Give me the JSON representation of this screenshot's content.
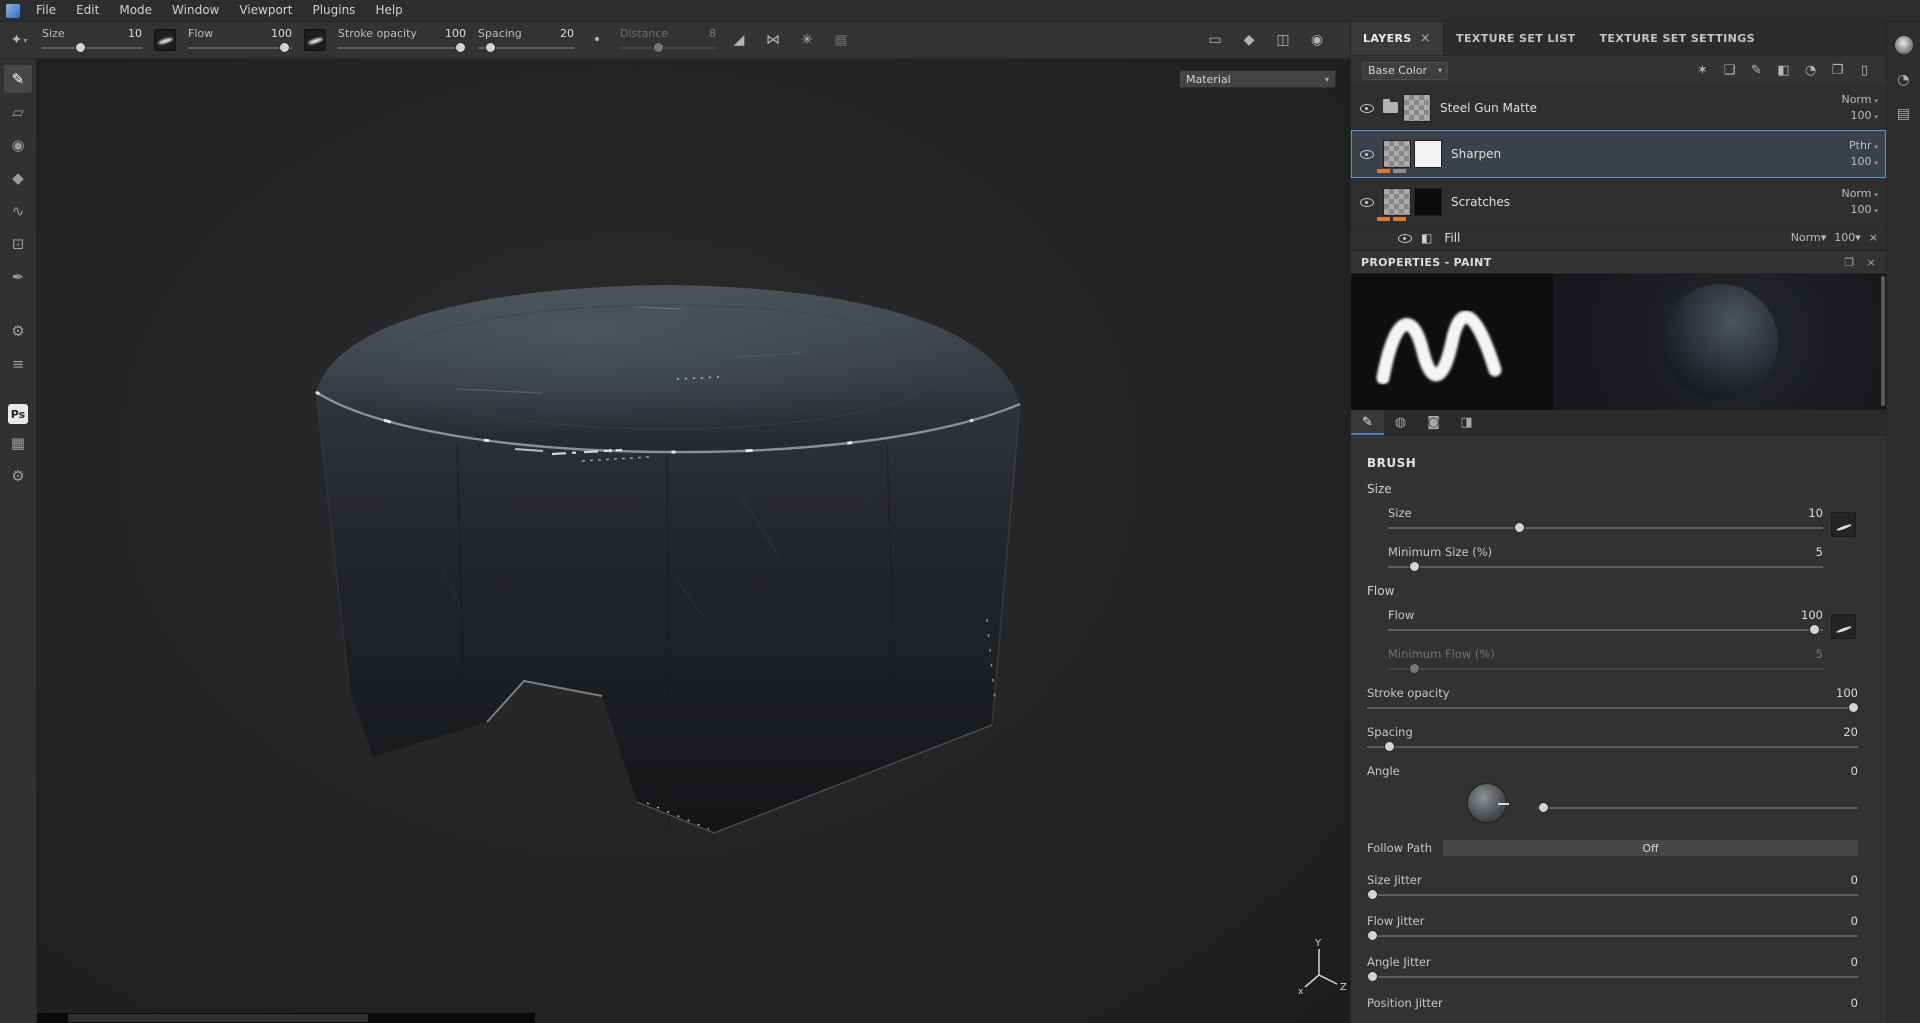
{
  "menubar": {
    "items": [
      "File",
      "Edit",
      "Mode",
      "Window",
      "Viewport",
      "Plugins",
      "Help"
    ]
  },
  "toolbar": {
    "size": {
      "label": "Size",
      "value": "10"
    },
    "flow": {
      "label": "Flow",
      "value": "100"
    },
    "stroke_opacity": {
      "label": "Stroke opacity",
      "value": "100"
    },
    "spacing": {
      "label": "Spacing",
      "value": "20"
    },
    "distance": {
      "label": "Distance",
      "value": "8"
    }
  },
  "viewport": {
    "material_select": "Material",
    "axis": {
      "x": "x",
      "y": "Y",
      "z": "Z"
    }
  },
  "layers_panel": {
    "tabs": [
      {
        "label": "LAYERS"
      },
      {
        "label": "TEXTURE SET LIST"
      },
      {
        "label": "TEXTURE SET SETTINGS"
      }
    ],
    "channel_select": "Base Color",
    "layers": [
      {
        "name": "Steel Gun Matte",
        "blend": "Norm",
        "opacity": "100"
      },
      {
        "name": "Sharpen",
        "blend": "Pthr",
        "opacity": "100"
      },
      {
        "name": "Scratches",
        "blend": "Norm",
        "opacity": "100"
      },
      {
        "name": "Fill",
        "blend": "Norm",
        "opacity": "100"
      }
    ]
  },
  "properties_panel": {
    "title": "PROPERTIES - PAINT",
    "section_title": "BRUSH",
    "group_size": "Size",
    "group_flow": "Flow",
    "rows": {
      "size": {
        "label": "Size",
        "value": "10"
      },
      "min_size": {
        "label": "Minimum Size (%)",
        "value": "5"
      },
      "flow": {
        "label": "Flow",
        "value": "100"
      },
      "min_flow": {
        "label": "Minimum Flow (%)",
        "value": "5"
      },
      "stroke_opacity": {
        "label": "Stroke opacity",
        "value": "100"
      },
      "spacing": {
        "label": "Spacing",
        "value": "20"
      },
      "angle": {
        "label": "Angle",
        "value": "0"
      },
      "follow_path": {
        "label": "Follow Path",
        "value": "Off"
      },
      "size_jitter": {
        "label": "Size Jitter",
        "value": "0"
      },
      "flow_jitter": {
        "label": "Flow Jitter",
        "value": "0"
      },
      "angle_jitter": {
        "label": "Angle Jitter",
        "value": "0"
      },
      "position_jitter": {
        "label": "Position Jitter",
        "value": "0"
      }
    }
  },
  "icons": {
    "chevron_down": "▾",
    "close": "×",
    "alpha_shape": "✦",
    "falloff_dot": "•",
    "lazy_mouse": "◢",
    "mirror_symmetry": "⋈",
    "radial_symmetry": "✳",
    "uv_symmetry": "▦",
    "display_settings": "▭",
    "material_mode": "◆",
    "camera_video": "◫",
    "camera": "◉",
    "layer_tools": [
      "✶",
      "❏",
      "✎",
      "◧",
      "◔",
      "❐",
      "▯"
    ],
    "fill_bucket": "◧",
    "prop_tabs": [
      "✎",
      "◍",
      "◙",
      "◨"
    ],
    "dock_tools": [
      "✎",
      "▱",
      "◉",
      "◆",
      "∿",
      "⊡",
      "✒"
    ],
    "dock_lower": [
      "⚙",
      "≡"
    ],
    "ps_badge": "Ps",
    "dock_bottom": [
      "▦",
      "⚙"
    ],
    "history": "◔",
    "notes": "▤",
    "restore": "❐"
  },
  "colors": {
    "selection_blue": "#5f93d1",
    "swatch_orange": "#e0752c",
    "accent_tab_underline": "#4d7fbd"
  }
}
